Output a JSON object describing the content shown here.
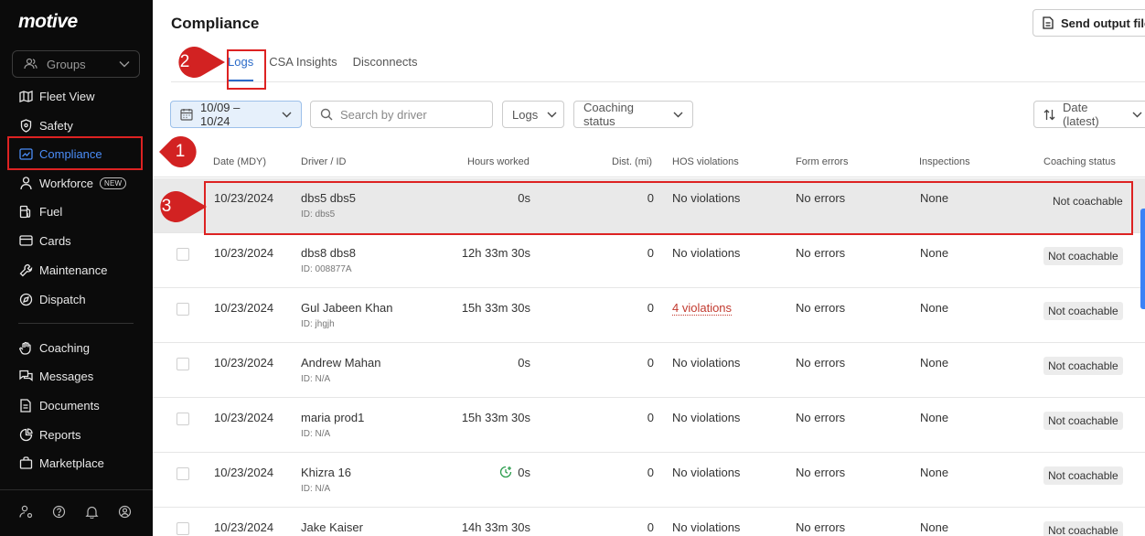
{
  "sidebar": {
    "logo": "motive",
    "groups_label": "Groups",
    "items": [
      {
        "label": "Fleet View",
        "icon": "fleet-view-icon"
      },
      {
        "label": "Safety",
        "icon": "shield-icon"
      },
      {
        "label": "Compliance",
        "icon": "compliance-icon"
      },
      {
        "label": "Workforce",
        "icon": "person-icon",
        "badge": "NEW"
      },
      {
        "label": "Fuel",
        "icon": "fuel-icon"
      },
      {
        "label": "Cards",
        "icon": "card-icon"
      },
      {
        "label": "Maintenance",
        "icon": "wrench-icon"
      },
      {
        "label": "Dispatch",
        "icon": "dispatch-icon"
      },
      {
        "label": "Coaching",
        "icon": "coaching-icon"
      },
      {
        "label": "Messages",
        "icon": "messages-icon"
      },
      {
        "label": "Documents",
        "icon": "document-icon"
      },
      {
        "label": "Reports",
        "icon": "reports-icon"
      },
      {
        "label": "Marketplace",
        "icon": "marketplace-icon"
      }
    ],
    "active_color": "#4a8df8"
  },
  "annotations": {
    "m1": "1",
    "m2": "2",
    "m3": "3",
    "color": "#d22222"
  },
  "header": {
    "title": "Compliance",
    "send_button": "Send output file"
  },
  "tabs": [
    {
      "label": "Logs",
      "active": true
    },
    {
      "label": "CSA Insights"
    },
    {
      "label": "Disconnects"
    }
  ],
  "filters": {
    "date_range": "10/09 – 10/24",
    "search_placeholder": "Search by driver",
    "logs": "Logs",
    "coaching_status": "Coaching status",
    "sort": "Date (latest)"
  },
  "table": {
    "columns": [
      "Date (MDY)",
      "Driver / ID",
      "Hours worked",
      "Dist. (mi)",
      "HOS violations",
      "Form errors",
      "Inspections",
      "Coaching status"
    ],
    "rows": [
      {
        "date": "10/23/2024",
        "driver": "dbs5 dbs5",
        "id": "ID: dbs5",
        "hours": "0s",
        "dist": "0",
        "hos": "No violations",
        "form": "No errors",
        "insp": "None",
        "coach": "Not coachable"
      },
      {
        "date": "10/23/2024",
        "driver": "dbs8 dbs8",
        "id": "ID: 008877A",
        "hours": "12h 33m 30s",
        "dist": "0",
        "hos": "No violations",
        "form": "No errors",
        "insp": "None",
        "coach": "Not coachable"
      },
      {
        "date": "10/23/2024",
        "driver": "Gul Jabeen Khan",
        "id": "ID: jhgjh",
        "hours": "15h 33m 30s",
        "dist": "0",
        "hos": "4 violations",
        "form": "No errors",
        "insp": "None",
        "coach": "Not coachable"
      },
      {
        "date": "10/23/2024",
        "driver": "Andrew Mahan",
        "id": "ID: N/A",
        "hours": "0s",
        "dist": "0",
        "hos": "No violations",
        "form": "No errors",
        "insp": "None",
        "coach": "Not coachable"
      },
      {
        "date": "10/23/2024",
        "driver": "maria prod1",
        "id": "ID: N/A",
        "hours": "15h 33m 30s",
        "dist": "0",
        "hos": "No violations",
        "form": "No errors",
        "insp": "None",
        "coach": "Not coachable"
      },
      {
        "date": "10/23/2024",
        "driver": "Khizra 16",
        "id": "ID: N/A",
        "hours": "0s",
        "dist": "0",
        "hos": "No violations",
        "form": "No errors",
        "insp": "None",
        "coach": "Not coachable"
      },
      {
        "date": "10/23/2024",
        "driver": "Jake Kaiser",
        "id": "",
        "hours": "14h 33m 30s",
        "dist": "0",
        "hos": "No violations",
        "form": "No errors",
        "insp": "None",
        "coach": "Not coachable"
      }
    ]
  }
}
